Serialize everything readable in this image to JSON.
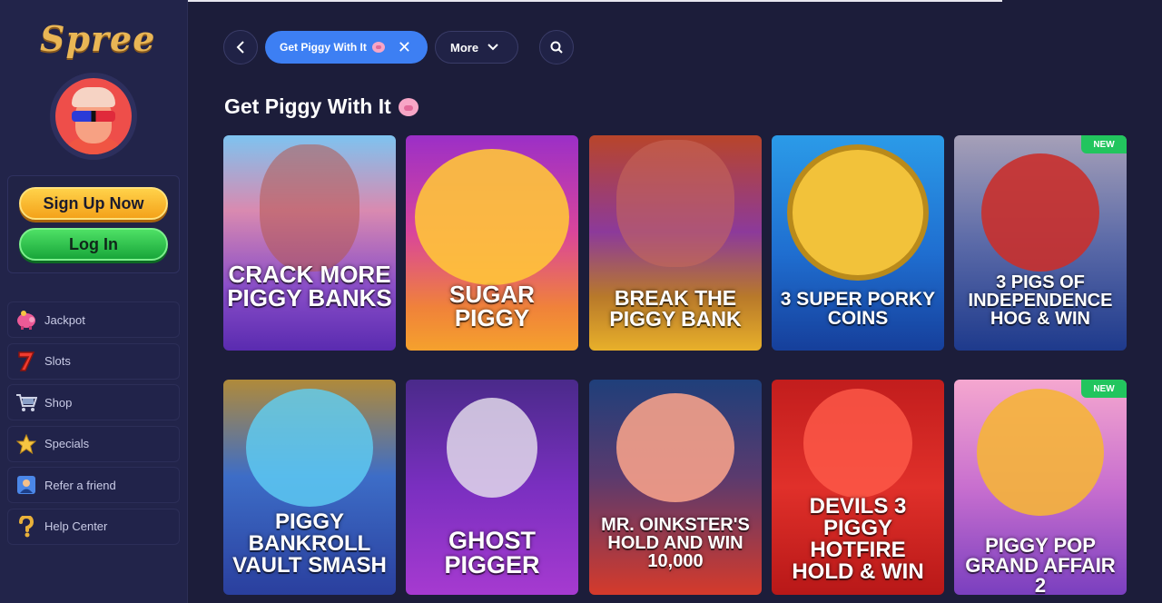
{
  "brand": {
    "logo_text": "Spree"
  },
  "auth": {
    "signup_label": "Sign Up Now",
    "login_label": "Log In"
  },
  "nav": [
    {
      "label": "Jackpot",
      "icon": "piggy-bank-icon"
    },
    {
      "label": "Slots",
      "icon": "seven-icon"
    },
    {
      "label": "Shop",
      "icon": "cart-icon"
    },
    {
      "label": "Specials",
      "icon": "star-icon"
    },
    {
      "label": "Refer a friend",
      "icon": "friend-icon"
    },
    {
      "label": "Help Center",
      "icon": "question-icon"
    }
  ],
  "filters": {
    "active_label": "Get Piggy With It",
    "more_label": "More"
  },
  "section": {
    "title": "Get Piggy With It"
  },
  "games": [
    {
      "title": "CRACK MORE PIGGY BANKS",
      "badge": ""
    },
    {
      "title": "SUGAR PIGGY",
      "badge": ""
    },
    {
      "title": "BREAK THE PIGGY BANK",
      "badge": ""
    },
    {
      "title": "3 SUPER PORKY COINS",
      "badge": ""
    },
    {
      "title": "3 PIGS OF INDEPENDENCE HOG & WIN",
      "badge": "NEW"
    },
    {
      "title": "PIGGY BANKROLL VAULT SMASH",
      "badge": ""
    },
    {
      "title": "GHOST PIGGER",
      "badge": ""
    },
    {
      "title": "MR. OINKSTER'S HOLD AND WIN 10,000",
      "badge": ""
    },
    {
      "title": "DEVILS 3 PIGGY HOTFIRE HOLD & WIN",
      "badge": ""
    },
    {
      "title": "PIGGY POP GRAND AFFAIR 2",
      "badge": "NEW"
    }
  ],
  "colors": {
    "accent": "#3d7ff3",
    "signup": "#f4a21a",
    "login": "#18a63a",
    "new_badge": "#22c55e"
  }
}
